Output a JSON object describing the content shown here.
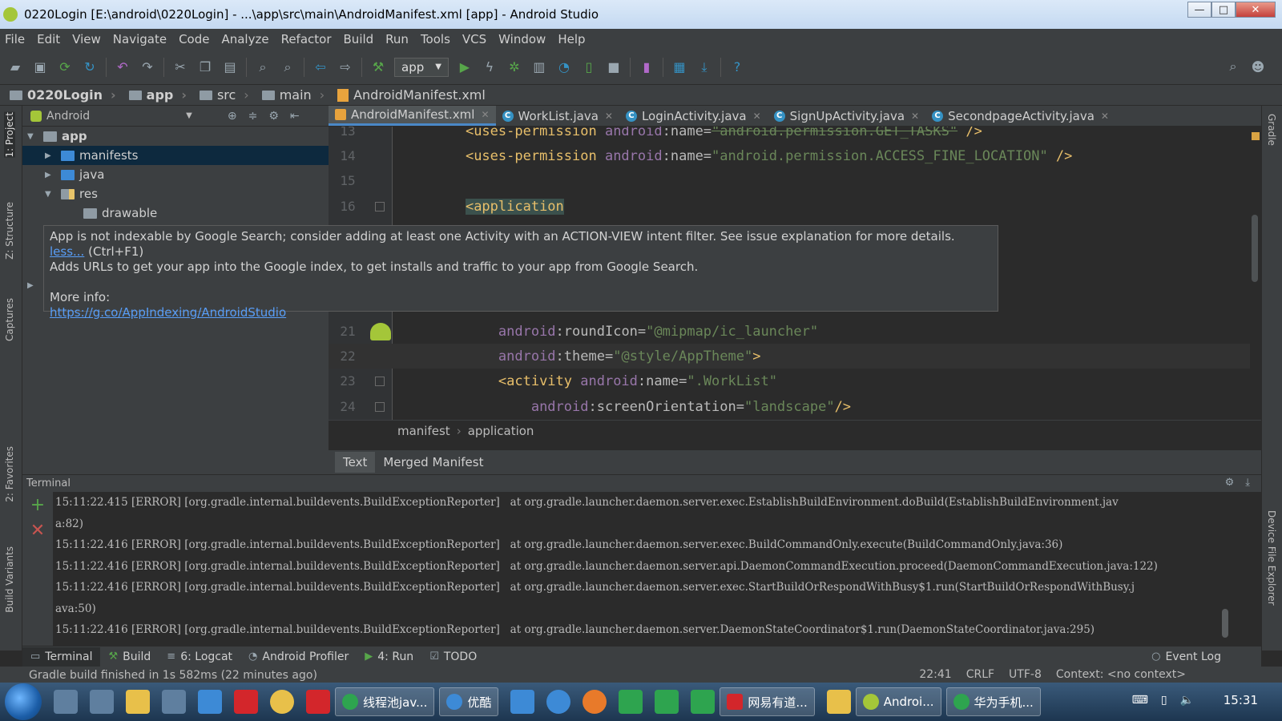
{
  "window": {
    "title": "0220Login [E:\\android\\0220Login] - ...\\app\\src\\main\\AndroidManifest.xml [app] - Android Studio",
    "minimize": "—",
    "maximize": "□",
    "close": "✕"
  },
  "menu": [
    "File",
    "Edit",
    "View",
    "Navigate",
    "Code",
    "Analyze",
    "Refactor",
    "Build",
    "Run",
    "Tools",
    "VCS",
    "Window",
    "Help"
  ],
  "toolbar": {
    "run_config": "app"
  },
  "breadcrumb": [
    "0220Login",
    "app",
    "src",
    "main",
    "AndroidManifest.xml"
  ],
  "left_stripe": [
    "1: Project",
    "Z: Structure",
    "Captures",
    "2: Favorites",
    "Build Variants"
  ],
  "right_stripe": [
    "Gradle",
    "Device File Explorer"
  ],
  "project": {
    "view_mode": "Android",
    "tree": [
      {
        "label": "app",
        "level": 0,
        "expanded": "▼"
      },
      {
        "label": "manifests",
        "level": 1,
        "expanded": "▶"
      },
      {
        "label": "java",
        "level": 1,
        "expanded": "▶"
      },
      {
        "label": "res",
        "level": 1,
        "expanded": "▼"
      },
      {
        "label": "drawable",
        "level": 2,
        "expanded": ""
      }
    ]
  },
  "editor_tabs": [
    {
      "label": "AndroidManifest.xml",
      "icon": "xml"
    },
    {
      "label": "WorkList.java",
      "icon": "C"
    },
    {
      "label": "LoginActivity.java",
      "icon": "C"
    },
    {
      "label": "SignUpActivity.java",
      "icon": "C"
    },
    {
      "label": "SecondpageActivity.java",
      "icon": "C"
    }
  ],
  "code": {
    "lines": [
      {
        "no": "13",
        "pre": "    ",
        "tag_open": "<uses-permission ",
        "attr": "android",
        "colon": ":",
        "name": "name=",
        "value": "\"android.permission.GET_TASKS\"",
        "close": " />"
      },
      {
        "no": "14",
        "pre": "    ",
        "tag_open": "<uses-permission ",
        "attr": "android",
        "colon": ":",
        "name": "name=",
        "value": "\"android.permission.ACCESS_FINE_LOCATION\"",
        "close": " />"
      },
      {
        "no": "15"
      },
      {
        "no": "16",
        "pre": "    ",
        "tag_open": "<application"
      },
      {
        "no": "21",
        "pre": "        ",
        "attr": "android",
        "colon": ":",
        "name": "roundIcon=",
        "value": "\"@mipmap/ic_launcher\""
      },
      {
        "no": "22",
        "pre": "        ",
        "attr": "android",
        "colon": ":",
        "name": "theme=",
        "value": "\"@style/AppTheme\"",
        "close": ">"
      },
      {
        "no": "23",
        "pre": "        ",
        "tag_open": "<activity ",
        "attr": "android",
        "colon": ":",
        "name": "name=",
        "value": "\".WorkList\""
      },
      {
        "no": "24",
        "pre": "            ",
        "attr": "android",
        "colon": ":",
        "name": "screenOrientation=",
        "value": "\"landscape\"",
        "close": "/>"
      }
    ]
  },
  "editor_breadcrumb": [
    "manifest",
    "application"
  ],
  "editor_subtabs": [
    "Text",
    "Merged Manifest"
  ],
  "tooltip": {
    "line1": "App is not indexable by Google Search; consider adding at least one Activity with an ACTION-VIEW intent filter. See issue explanation for more details.",
    "less_link": "less...",
    "shortcut": "(Ctrl+F1)",
    "line2": "Adds URLs to get your app into the Google index, to get installs and traffic to your app from Google Search.",
    "more_info": "More info:",
    "url": "https://g.co/AppIndexing/AndroidStudio"
  },
  "terminal": {
    "title": "Terminal",
    "lines": [
      "15:11:22.415 [ERROR] [org.gradle.internal.buildevents.BuildExceptionReporter]   at org.gradle.launcher.daemon.server.exec.EstablishBuildEnvironment.doBuild(EstablishBuildEnvironment.jav",
      "a:82)",
      "15:11:22.416 [ERROR] [org.gradle.internal.buildevents.BuildExceptionReporter]   at org.gradle.launcher.daemon.server.exec.BuildCommandOnly.execute(BuildCommandOnly.java:36)",
      "15:11:22.416 [ERROR] [org.gradle.internal.buildevents.BuildExceptionReporter]   at org.gradle.launcher.daemon.server.api.DaemonCommandExecution.proceed(DaemonCommandExecution.java:122)",
      "15:11:22.416 [ERROR] [org.gradle.internal.buildevents.BuildExceptionReporter]   at org.gradle.launcher.daemon.server.exec.StartBuildOrRespondWithBusy$1.run(StartBuildOrRespondWithBusy.j",
      "ava:50)",
      "15:11:22.416 [ERROR] [org.gradle.internal.buildevents.BuildExceptionReporter]   at org.gradle.launcher.daemon.server.DaemonStateCoordinator$1.run(DaemonStateCoordinator.java:295)"
    ]
  },
  "bottom_tools": [
    {
      "label": "Terminal",
      "icon": "terminal-icon"
    },
    {
      "label": "Build",
      "icon": "build-icon"
    },
    {
      "label": "6: Logcat",
      "icon": "logcat-icon"
    },
    {
      "label": "Android Profiler",
      "icon": "profiler-icon"
    },
    {
      "label": "4: Run",
      "icon": "run-icon"
    },
    {
      "label": "TODO",
      "icon": "todo-icon"
    }
  ],
  "event_log": "Event Log",
  "status": {
    "message": "Gradle build finished in 1s 582ms (22 minutes ago)",
    "position": "22:41",
    "line_sep": "CRLF",
    "encoding": "UTF-8",
    "context": "Context: <no context>"
  },
  "taskbar": {
    "tasks": [
      "线程池jav...",
      "优酷",
      "网易有道...",
      "Androi...",
      "华为手机..."
    ],
    "clock": "15:31"
  }
}
